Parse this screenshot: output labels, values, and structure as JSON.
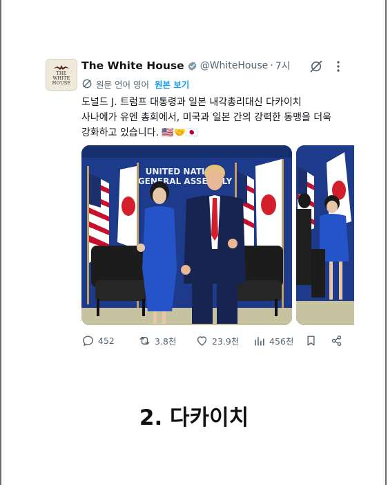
{
  "post": {
    "account": {
      "avatar_text": "THE\nWHITE\nHOUSE",
      "display_name": "The White House",
      "handle": "@WhiteHouse",
      "separator": "·",
      "time": "7시",
      "verified_icon": "verified-badge-icon"
    },
    "translation": {
      "note": "원문 언어 영어",
      "show_original_label": "원본 보기"
    },
    "text_lines": [
      "도널드 J. 트럼프 대통령과 일본 내각총리대신 다카이치",
      "사나에가 유엔 총회에서, 미국과 일본 간의 강력한 동맹을 더욱",
      "강화하고 있습니다. 🇺🇸🤝🇯🇵"
    ],
    "media": {
      "backdrop_text_line1": "UNITED NATIONS",
      "backdrop_text_line2": "GENERAL ASSEMBLY"
    },
    "actions": {
      "replies": "452",
      "reposts": "3.8천",
      "likes": "23.9천",
      "views": "456천"
    }
  },
  "caption": "2. 다카이치",
  "colors": {
    "link": "#1d9bf0",
    "muted": "#536471",
    "verified": "#829aab",
    "backdrop_blue": "#1e3a8a",
    "suit_blue": "#2454c7",
    "tie_red": "#d21f2b"
  }
}
